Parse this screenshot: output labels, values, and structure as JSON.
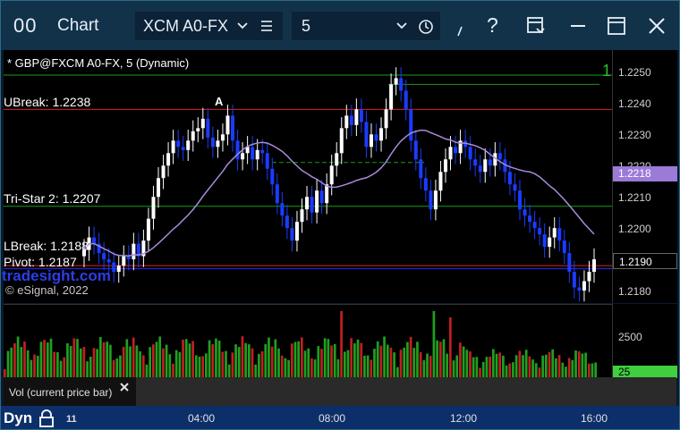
{
  "window": {
    "title": "Chart",
    "logo": "00",
    "icons": [
      "help-icon",
      "save-icon",
      "minimize-icon",
      "maximize-icon",
      "close-icon"
    ],
    "help_label": "?"
  },
  "toolbar": {
    "symbol_value": "XCM A0-FX",
    "interval_value": "5"
  },
  "chart": {
    "heading": "* GBP@FXCM A0-FX, 5 (Dynamic)",
    "copyright": "© eSignal, 2022",
    "watermark": "tradesight.com",
    "labels": {
      "ubreak": "UBreak: 1.2238",
      "tristar": "Tri-Star 2: 1.2207",
      "lbreak": "LBreak: 1.2188",
      "pivot": "Pivot: 1.2187",
      "marker_a": "A",
      "marker_one": "1"
    },
    "price_ticks": [
      "1.2250",
      "1.2240",
      "1.2230",
      "1.2220",
      "1.2210",
      "1.2200",
      "1.2180"
    ],
    "current_price": "1.2190",
    "ma_price": "1.2218",
    "colors": {
      "up": "#ffffff",
      "down": "#1a3cff",
      "ma": "#a88ad8",
      "resistance": "#e02020",
      "support_line": "#1a9a1a",
      "pivot": "#2a2aff",
      "count_pink": "#ff2aff",
      "count_green": "#27d427"
    }
  },
  "volume": {
    "tick": "2500",
    "current": "25",
    "study_label": "Vol (current price bar)"
  },
  "time_axis": {
    "mode": "Dyn",
    "labels": [
      "11",
      "04:00",
      "08:00",
      "12:00",
      "16:00"
    ]
  },
  "chart_data": [
    {
      "type": "candlestick",
      "title": "* GBP@FXCM A0-FX, 5 (Dynamic)",
      "x_ticks": [
        "04:00",
        "08:00",
        "12:00",
        "16:00"
      ],
      "y_ticks": [
        1.225,
        1.224,
        1.223,
        1.222,
        1.221,
        1.22,
        1.218
      ],
      "ylim": [
        1.2176,
        1.2257
      ],
      "levels": [
        {
          "name": "UBreak",
          "value": 1.2238
        },
        {
          "name": "Tri-Star 2",
          "value": 1.2207
        },
        {
          "name": "LBreak",
          "value": 1.2188
        },
        {
          "name": "Pivot",
          "value": 1.2187
        }
      ],
      "current_price": 1.219,
      "closes": [
        1.2193,
        1.2197,
        1.2195,
        1.2192,
        1.219,
        1.2189,
        1.2186,
        1.2188,
        1.2191,
        1.219,
        1.2195,
        1.2191,
        1.2196,
        1.2203,
        1.221,
        1.2216,
        1.222,
        1.2224,
        1.2228,
        1.2226,
        1.2225,
        1.2228,
        1.2231,
        1.2232,
        1.2235,
        1.2229,
        1.2226,
        1.2228,
        1.223,
        1.2236,
        1.2228,
        1.2222,
        1.2224,
        1.2226,
        1.2222,
        1.2225,
        1.2224,
        1.2219,
        1.2214,
        1.2208,
        1.2204,
        1.22,
        1.2196,
        1.2202,
        1.2206,
        1.221,
        1.2205,
        1.2212,
        1.2208,
        1.2214,
        1.222,
        1.2224,
        1.2232,
        1.2236,
        1.2233,
        1.2238,
        1.2234,
        1.2226,
        1.223,
        1.2228,
        1.2232,
        1.2238,
        1.2246,
        1.2248,
        1.2244,
        1.2238,
        1.2228,
        1.2222,
        1.2216,
        1.2212,
        1.2206,
        1.2212,
        1.2218,
        1.2222,
        1.2226,
        1.2224,
        1.2228,
        1.2226,
        1.2222,
        1.222,
        1.2218,
        1.2222,
        1.222,
        1.2224,
        1.2222,
        1.2218,
        1.2214,
        1.2212,
        1.2206,
        1.2204,
        1.2202,
        1.22,
        1.2198,
        1.2194,
        1.2197,
        1.22,
        1.2196,
        1.2192,
        1.2186,
        1.2181,
        1.218,
        1.2183,
        1.2186,
        1.219
      ]
    },
    {
      "type": "bar",
      "title": "Vol (current price bar)",
      "y_ticks": [
        2500
      ],
      "current": 25
    }
  ]
}
